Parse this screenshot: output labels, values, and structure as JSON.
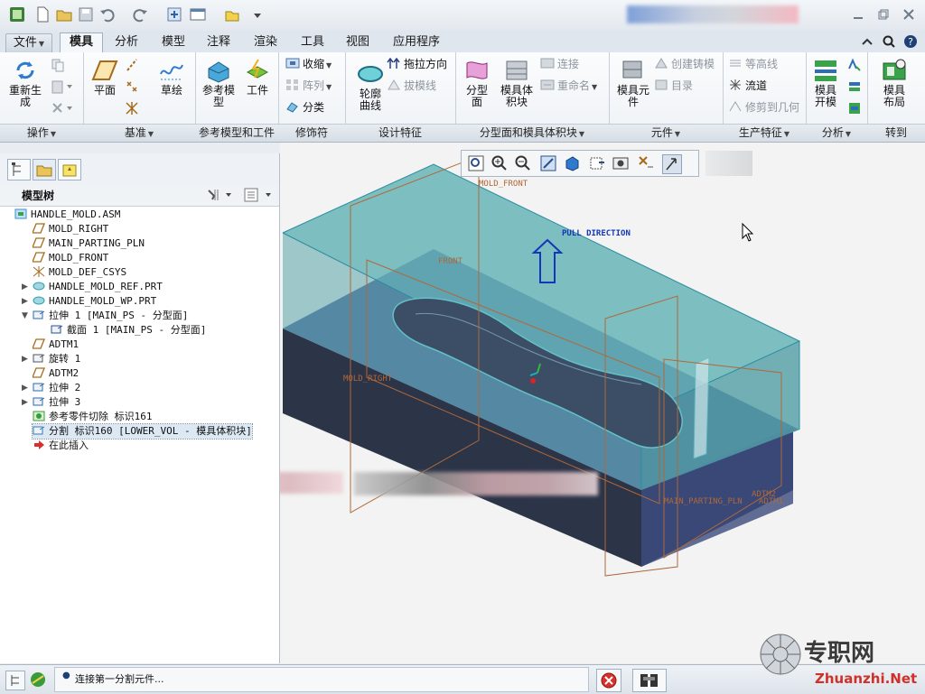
{
  "colors": {
    "accent": "#1f5fa8",
    "mold_volume": "#5aa3a8",
    "mold_bottom": "#2c3448",
    "datum": "#b0683a",
    "pull_direction": "#1436b8"
  },
  "tabs": [
    {
      "label": "文件",
      "icon": "chevron-down-icon"
    },
    {
      "label": "模具"
    },
    {
      "label": "分析"
    },
    {
      "label": "模型"
    },
    {
      "label": "注释"
    },
    {
      "label": "渲染"
    },
    {
      "label": "工具"
    },
    {
      "label": "视图"
    },
    {
      "label": "应用程序"
    }
  ],
  "ribbon": {
    "groups": [
      "操作",
      "基准",
      "参考模型和工件",
      "修饰符",
      "设计特征",
      "分型面和模具体积块",
      "元件",
      "生产特征",
      "分析",
      "转到"
    ],
    "ops": {
      "regen": "重新生\n成"
    },
    "datum": {
      "plane": "平面",
      "sketch": "草绘"
    },
    "refmodel": {
      "ref": "参考模\n型",
      "workpiece": "工件"
    },
    "mods": {
      "shrink": "收缩",
      "pattern": "阵列",
      "classify": "分类"
    },
    "design": {
      "outline": "轮廓\n曲线",
      "pull": "拖拉方向",
      "draft": "拔模线"
    },
    "parting": {
      "surface": "分型\n面",
      "volume": "模具体\n积块",
      "connect": "连接",
      "rename": "重命名"
    },
    "component": {
      "element": "模具元\n件",
      "casting": "创建铸模",
      "directory": "目录"
    },
    "production": {
      "contour": "等高线",
      "flow": "流道",
      "trim": "修剪到几何"
    },
    "analysis": {
      "open": "模具\n开模"
    },
    "goto": {
      "layout": "模具\n布局"
    }
  },
  "tree": {
    "title": "模型树",
    "items": [
      {
        "label": "HANDLE_MOLD.ASM",
        "icon": "assembly-icon"
      },
      {
        "label": "MOLD_RIGHT",
        "icon": "datum-plane-icon"
      },
      {
        "label": "MAIN_PARTING_PLN",
        "icon": "datum-plane-icon"
      },
      {
        "label": "MOLD_FRONT",
        "icon": "datum-plane-icon"
      },
      {
        "label": "MOLD_DEF_CSYS",
        "icon": "csys-icon"
      },
      {
        "label": "HANDLE_MOLD_REF.PRT",
        "icon": "part-icon"
      },
      {
        "label": "HANDLE_MOLD_WP.PRT",
        "icon": "part-icon"
      },
      {
        "label": "拉伸 1 [MAIN_PS - 分型面]",
        "icon": "extrude-icon"
      },
      {
        "label": "截面 1 [MAIN_PS - 分型面]",
        "icon": "sketch-icon"
      },
      {
        "label": "ADTM1",
        "icon": "datum-plane-icon"
      },
      {
        "label": "旋转 1",
        "icon": "revolve-icon"
      },
      {
        "label": "ADTM2",
        "icon": "datum-plane-icon"
      },
      {
        "label": "拉伸 2",
        "icon": "extrude-icon"
      },
      {
        "label": "拉伸 3",
        "icon": "extrude-icon"
      },
      {
        "label": "参考零件切除 标识161",
        "icon": "cutout-icon"
      },
      {
        "label": "分割 标识160 [LOWER_VOL - 模具体积块]",
        "icon": "split-icon"
      },
      {
        "label": "在此插入",
        "icon": "insert-here-icon"
      }
    ]
  },
  "viewport": {
    "labels": {
      "mold_front": "MOLD_FRONT",
      "pull_direction": "PULL DIRECTION",
      "front": "FRONT",
      "mold_right": "MOLD_RIGHT",
      "adtm2": "ADTM2",
      "main_parting": "MAIN_PARTING_PLN",
      "adtm1": "ADTM1"
    }
  },
  "status": {
    "message": "连接第一分割元件..."
  },
  "watermark": {
    "brand": "专职网",
    "url": "Zhuanzhi.Net"
  }
}
